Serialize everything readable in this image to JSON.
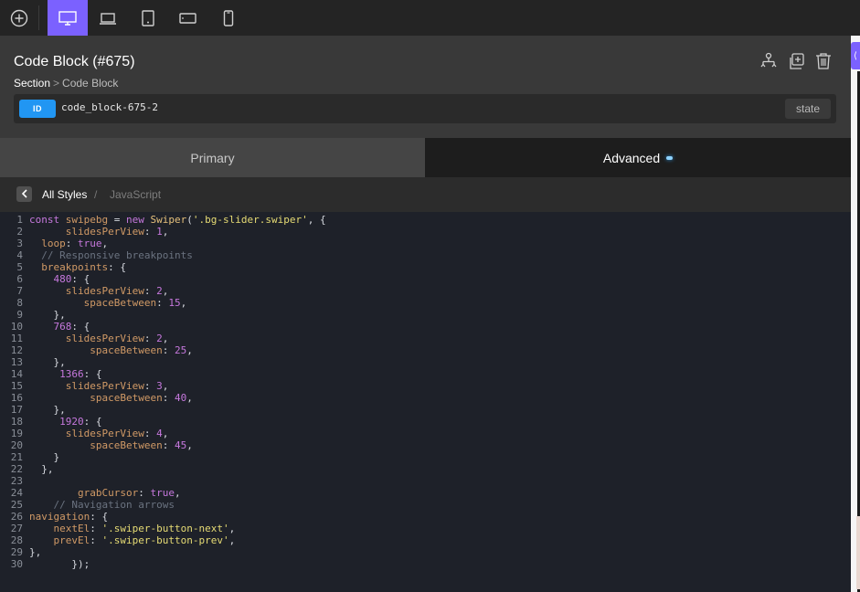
{
  "toolbar": {
    "add_icon": "plus-circle-icon",
    "devices": [
      {
        "name": "desktop",
        "icon": "desktop-icon",
        "active": true
      },
      {
        "name": "laptop",
        "icon": "laptop-icon",
        "active": false
      },
      {
        "name": "tablet-portrait",
        "icon": "tablet-portrait-icon",
        "active": false
      },
      {
        "name": "tablet-landscape",
        "icon": "tablet-landscape-icon",
        "active": false
      },
      {
        "name": "mobile",
        "icon": "mobile-icon",
        "active": false
      }
    ],
    "accent_color": "#7b61ff"
  },
  "element": {
    "title": "Code Block (#675)",
    "breadcrumb": {
      "parent": "Section",
      "separator": ">",
      "current": "Code Block"
    },
    "actions": [
      "structure-icon",
      "duplicate-icon",
      "trash-icon"
    ]
  },
  "selector": {
    "badge": "ID",
    "value": "code_block-675-2",
    "state_label": "state"
  },
  "tabs": [
    {
      "label": "Primary",
      "active": false
    },
    {
      "label": "Advanced",
      "active": true
    }
  ],
  "subnav": {
    "back_label": "All Styles",
    "separator": "/",
    "current": "JavaScript"
  },
  "code": {
    "language": "JavaScript",
    "lines": [
      "const swipebg = new Swiper('.bg-slider.swiper', {",
      "      slidesPerView: 1,",
      "  loop: true,",
      "  // Responsive breakpoints",
      "  breakpoints: {",
      "    480: {",
      "      slidesPerView: 2,",
      "         spaceBetween: 15,",
      "    },",
      "    768: {",
      "      slidesPerView: 2,",
      "          spaceBetween: 25,",
      "    },",
      "     1366: {",
      "      slidesPerView: 3,",
      "          spaceBetween: 40,",
      "    },",
      "     1920: {",
      "      slidesPerView: 4,",
      "          spaceBetween: 45,",
      "    }",
      "  },",
      "",
      "        grabCursor: true,",
      "    // Navigation arrows",
      "navigation: {",
      "    nextEl: '.swiper-button-next',",
      "    prevEl: '.swiper-button-prev',",
      "},",
      "       });"
    ]
  }
}
